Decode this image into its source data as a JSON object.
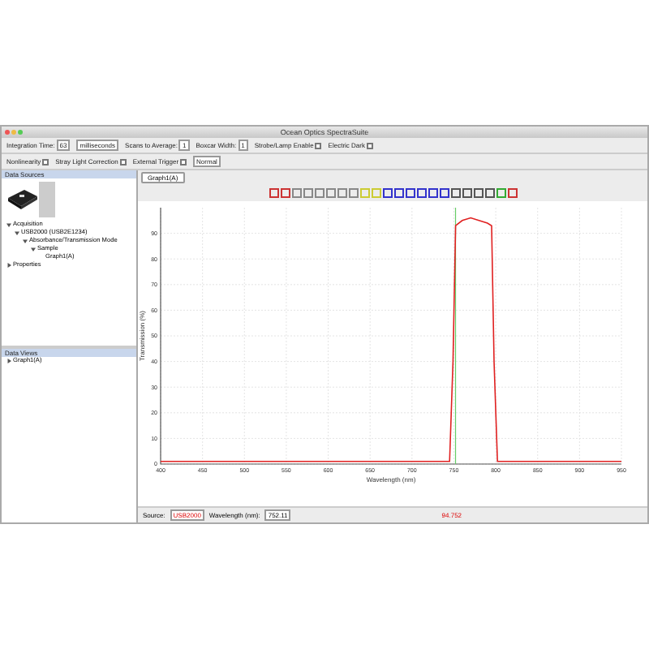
{
  "window": {
    "title": "Ocean Optics SpectraSuite"
  },
  "toolbar_rows": [
    [
      {
        "kind": "spinner",
        "label": "Integration Time:",
        "value": "63"
      },
      {
        "kind": "select",
        "value": "milliseconds"
      },
      {
        "kind": "spinner",
        "label": "Scans to Average:",
        "value": "1"
      },
      {
        "kind": "spinner",
        "label": "Boxcar Width:",
        "value": "1"
      },
      {
        "kind": "checkbox",
        "label": "Strobe/Lamp Enable",
        "checked": false
      },
      {
        "kind": "checkbox",
        "label": "Electric Dark",
        "checked": false
      }
    ],
    [
      {
        "kind": "checkbox",
        "label": "Nonlinearity",
        "checked": false
      },
      {
        "kind": "checkbox",
        "label": "Stray Light Correction",
        "checked": false
      },
      {
        "kind": "checkbox",
        "label": "External Trigger",
        "checked": false
      },
      {
        "kind": "select",
        "value": "Normal"
      }
    ]
  ],
  "data_sources": {
    "title": "Data Sources",
    "tree": [
      {
        "label": "Acquisition",
        "expanded": true,
        "children": [
          {
            "label": "USB2000 (USB2E1234)",
            "expanded": true,
            "children": [
              {
                "label": "Absorbance/Transmission Mode",
                "expanded": true,
                "children": [
                  {
                    "label": "Sample",
                    "expanded": true,
                    "children": [
                      {
                        "label": "Graph1(A)"
                      }
                    ]
                  }
                ]
              }
            ]
          }
        ]
      },
      {
        "label": "Properties",
        "expanded": false
      }
    ]
  },
  "data_views": {
    "title": "Data Views",
    "tree": [
      {
        "label": "Graph1(A)",
        "expanded": false
      }
    ]
  },
  "graph_tab": {
    "label": "Graph1(A)"
  },
  "chart_data": {
    "type": "line",
    "xlabel": "Wavelength (nm)",
    "ylabel": "Transmission (%)",
    "xlim": [
      400,
      950
    ],
    "ylim": [
      0,
      100
    ],
    "xticks": [
      400,
      450,
      500,
      550,
      600,
      650,
      700,
      750,
      800,
      850,
      900,
      950
    ],
    "yticks": [
      0,
      10,
      20,
      30,
      40,
      50,
      60,
      70,
      80,
      90
    ],
    "grid": true,
    "ref_lines": [
      {
        "axis": "x",
        "value": 752,
        "color": "#66cc66"
      }
    ],
    "series": [
      {
        "color": "#e02020",
        "x": [
          400,
          500,
          600,
          700,
          745,
          749,
          752,
          760,
          770,
          780,
          790,
          795,
          798,
          802,
          850,
          950
        ],
        "values": [
          1,
          1,
          1,
          1,
          1,
          40,
          93,
          95,
          96,
          95,
          94,
          93,
          40,
          1,
          1,
          1
        ]
      }
    ]
  },
  "status": {
    "source_label": "Source:",
    "source_value": "USB2000",
    "wavelength_label": "Wavelength (nm):",
    "wavelength_value": "752.11",
    "reading": "94.752"
  }
}
